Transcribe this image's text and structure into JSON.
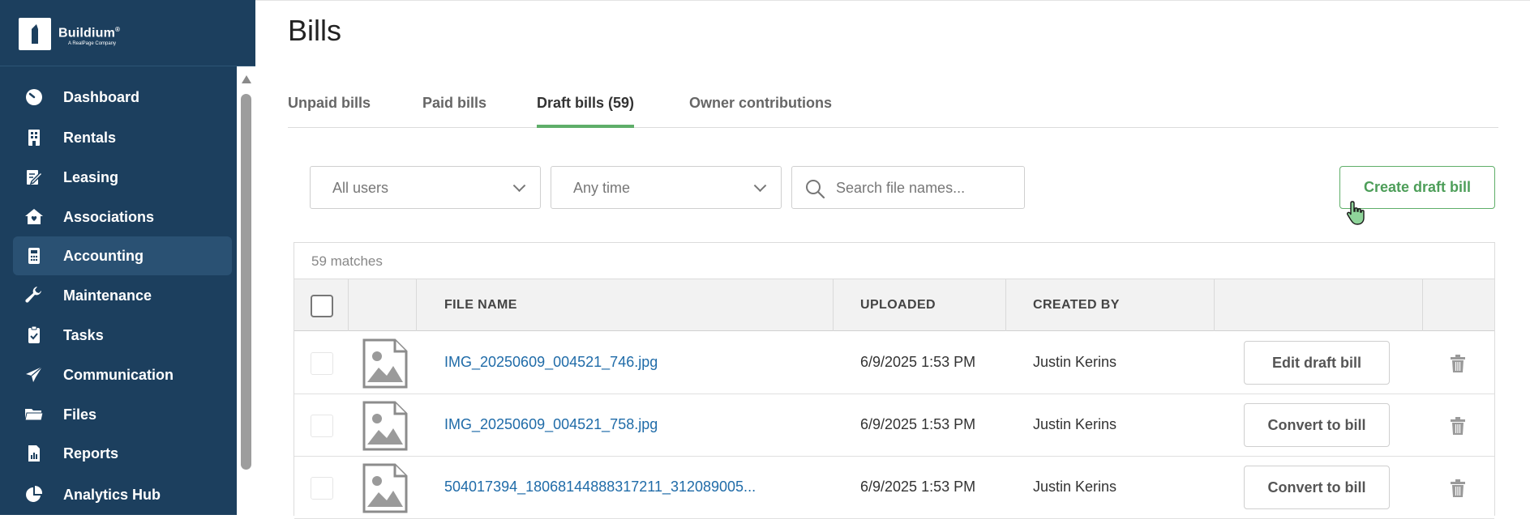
{
  "brand": {
    "name": "Buildium",
    "trademark": "®",
    "tagline": "A RealPage Company"
  },
  "sidebar": {
    "items": [
      {
        "label": "Dashboard",
        "icon": "dashboard-gauge-icon"
      },
      {
        "label": "Rentals",
        "icon": "building-icon"
      },
      {
        "label": "Leasing",
        "icon": "lease-document-icon"
      },
      {
        "label": "Associations",
        "icon": "home-heart-icon"
      },
      {
        "label": "Accounting",
        "icon": "calculator-icon",
        "active": true
      },
      {
        "label": "Maintenance",
        "icon": "wrench-icon"
      },
      {
        "label": "Tasks",
        "icon": "clipboard-check-icon"
      },
      {
        "label": "Communication",
        "icon": "paper-plane-icon"
      },
      {
        "label": "Files",
        "icon": "folder-icon"
      },
      {
        "label": "Reports",
        "icon": "report-chart-icon"
      },
      {
        "label": "Analytics Hub",
        "icon": "pie-chart-icon"
      }
    ]
  },
  "page": {
    "title": "Bills"
  },
  "tabs": [
    {
      "label": "Unpaid bills",
      "active": false
    },
    {
      "label": "Paid bills",
      "active": false
    },
    {
      "label": "Draft bills (59)",
      "active": true
    },
    {
      "label": "Owner contributions",
      "active": false
    }
  ],
  "filters": {
    "users": "All users",
    "time": "Any time",
    "search_placeholder": "Search file names..."
  },
  "actions": {
    "create_draft_bill": "Create draft bill"
  },
  "table": {
    "match_count": "59 matches",
    "columns": [
      "FILE NAME",
      "UPLOADED",
      "CREATED BY"
    ],
    "rows": [
      {
        "file_name": "IMG_20250609_004521_746.jpg",
        "uploaded": "6/9/2025 1:53 PM",
        "created_by": "Justin Kerins",
        "action": "Edit draft bill"
      },
      {
        "file_name": "IMG_20250609_004521_758.jpg",
        "uploaded": "6/9/2025 1:53 PM",
        "created_by": "Justin Kerins",
        "action": "Convert to bill"
      },
      {
        "file_name": "504017394_18068144888317211_312089005...",
        "uploaded": "6/9/2025 1:53 PM",
        "created_by": "Justin Kerins",
        "action": "Convert to bill"
      }
    ]
  },
  "colors": {
    "sidebar_bg": "#1c3f5e",
    "sidebar_active": "#2a5173",
    "accent_green": "#5fae69",
    "link_blue": "#1f6ba8"
  }
}
